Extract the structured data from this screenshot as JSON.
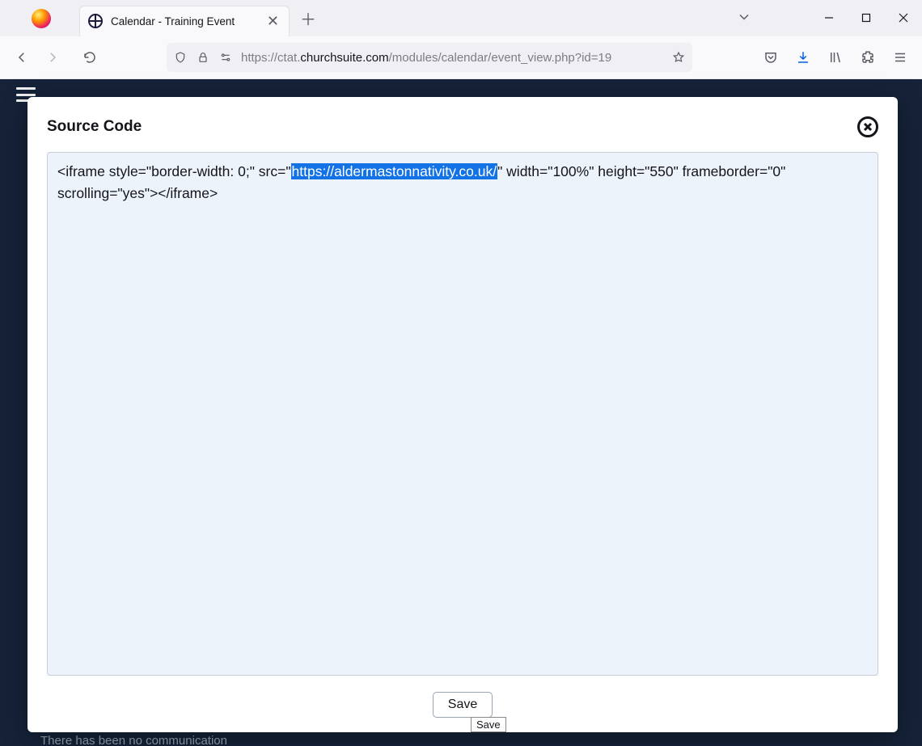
{
  "tab": {
    "title": "Calendar - Training Event",
    "close_glyph": "✕"
  },
  "newtab_glyph": "＋",
  "url": {
    "scheme": "https://",
    "sub": "ctat.",
    "host": "churchsuite.com",
    "path": "/modules/calendar/event_view.php?id=19"
  },
  "page": {
    "footer_text": "There has been no communication"
  },
  "modal": {
    "title": "Source Code",
    "code_pre": "<iframe style=\"border-width: 0;\" src=\"",
    "code_url": "https://aldermastonnativity.co.uk/",
    "code_post": "\" width=\"100%\" height=\"550\" frameborder=\"0\" scrolling=\"yes\"></iframe>",
    "save_label": "Save",
    "tooltip": "Save"
  }
}
